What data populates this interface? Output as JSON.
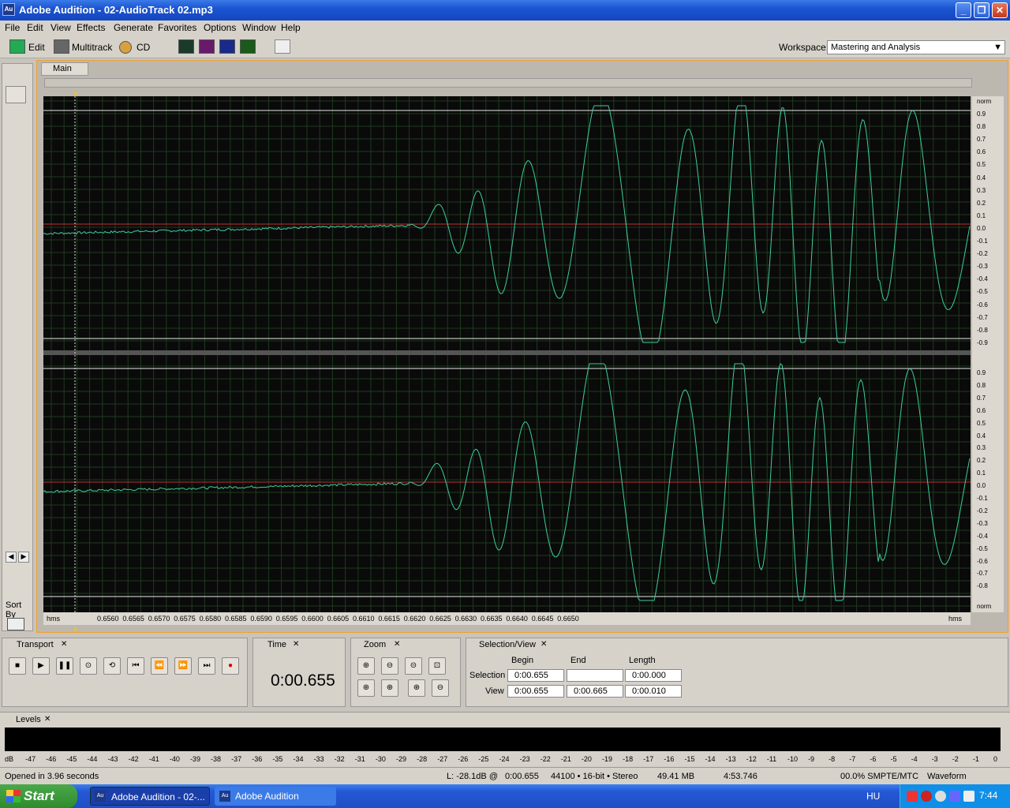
{
  "window": {
    "title": "Adobe Audition - 02-AudioTrack 02.mp3",
    "app_icon": "Au"
  },
  "menu": [
    "File",
    "Edit",
    "View",
    "Effects",
    "Generate",
    "Favorites",
    "Options",
    "Window",
    "Help"
  ],
  "toolbar": {
    "edit_label": "Edit",
    "multitrack_label": "Multitrack",
    "cd_label": "CD",
    "workspace_label": "Workspace:",
    "workspace_value": "Mastering and Analysis"
  },
  "main_tab": "Main",
  "channel_scale": {
    "top_label": "norm",
    "bottom_label": "norm",
    "ticks": [
      "0.9",
      "0.8",
      "0.7",
      "0.6",
      "0.5",
      "0.4",
      "0.3",
      "0.2",
      "0.1",
      "0.0",
      "-0.1",
      "-0.2",
      "-0.3",
      "-0.4",
      "-0.5",
      "-0.6",
      "-0.7",
      "-0.8",
      "-0.9"
    ]
  },
  "time_ruler": {
    "left_label": "hms",
    "right_label": "hms",
    "ticks": [
      "0.6560",
      "0.6565",
      "0.6570",
      "0.6575",
      "0.6580",
      "0.6585",
      "0.6590",
      "0.6595",
      "0.6600",
      "0.6605",
      "0.6610",
      "0.6615",
      "0.6620",
      "0.6625",
      "0.6630",
      "0.6635",
      "0.6640",
      "0.6645",
      "0.6650"
    ]
  },
  "left_panel": {
    "sort_label": "Sort By"
  },
  "transport": {
    "tab": "Transport"
  },
  "time": {
    "tab": "Time",
    "value": "0:00.655"
  },
  "zoom": {
    "tab": "Zoom"
  },
  "selection_view": {
    "tab": "Selection/View",
    "headers": [
      "Begin",
      "End",
      "Length"
    ],
    "selection": {
      "label": "Selection",
      "begin": "0:00.655",
      "end": "",
      "length": "0:00.000"
    },
    "view": {
      "label": "View",
      "begin": "0:00.655",
      "end": "0:00.665",
      "length": "0:00.010"
    }
  },
  "levels": {
    "tab": "Levels",
    "scale": [
      "dB",
      "-47",
      "-46",
      "-45",
      "-44",
      "-43",
      "-42",
      "-41",
      "-40",
      "-39",
      "-38",
      "-37",
      "-36",
      "-35",
      "-34",
      "-33",
      "-32",
      "-31",
      "-30",
      "-29",
      "-28",
      "-27",
      "-26",
      "-25",
      "-24",
      "-23",
      "-22",
      "-21",
      "-20",
      "-19",
      "-18",
      "-17",
      "-16",
      "-15",
      "-14",
      "-13",
      "-12",
      "-11",
      "-10",
      "-9",
      "-8",
      "-7",
      "-6",
      "-5",
      "-4",
      "-3",
      "-2",
      "-1",
      "0"
    ]
  },
  "status": {
    "message": "Opened in 3.96 seconds",
    "level": "L: -28.1dB @",
    "position": "0:00.655",
    "format": "44100 • 16-bit • Stereo",
    "size": "49.41 MB",
    "duration": "4:53.746",
    "smpte": "00.0% SMPTE/MTC",
    "view": "Waveform"
  },
  "taskbar": {
    "start": "Start",
    "tasks": [
      "Adobe Audition - 02-...",
      "Adobe Audition"
    ],
    "lang": "HU",
    "clock": "7:44"
  },
  "colors": {
    "waveform": "#3ccf9a",
    "centerline": "#c03030",
    "grid": "#1f3a1f",
    "background": "#0a0a0a"
  }
}
